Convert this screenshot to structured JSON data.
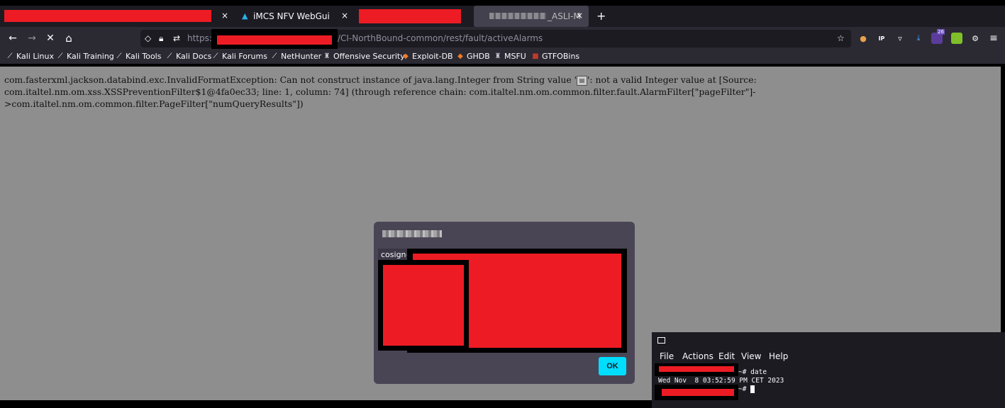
{
  "tabs": [
    {
      "label": "",
      "close": "×"
    },
    {
      "label": "iMCS NFV WebGui",
      "close": "×"
    },
    {
      "label": "",
      "close": ""
    },
    {
      "label": "_ASLI-M",
      "close": "×"
    }
  ],
  "new_tab": "+",
  "nav": {
    "back": "←",
    "forward": "→",
    "stop": "✕",
    "home": "⌂",
    "url_prefix": "https:/",
    "url_suffix": "/CI-NorthBound-common/rest/fault/activeAlarms"
  },
  "toolbar": {
    "badge_count": "26",
    "ip_label": "IP",
    "menu": "≡"
  },
  "bookmarks": [
    {
      "label": "Kali Linux",
      "icon": "kali-dragon-icon"
    },
    {
      "label": "Kali Training",
      "icon": "kali-dragon-icon"
    },
    {
      "label": "Kali Tools",
      "icon": "kali-dragon-icon"
    },
    {
      "label": "Kali Docs",
      "icon": "kali-dragon-icon"
    },
    {
      "label": "Kali Forums",
      "icon": "kali-dragon-icon"
    },
    {
      "label": "NetHunter",
      "icon": "kali-dragon-icon"
    },
    {
      "label": "Offensive Security",
      "icon": "offsec-icon"
    },
    {
      "label": "Exploit-DB",
      "icon": "exploitdb-icon"
    },
    {
      "label": "GHDB",
      "icon": "ghdb-icon"
    },
    {
      "label": "MSFU",
      "icon": "msfu-icon"
    },
    {
      "label": "GTFOBins",
      "icon": "gtfobins-icon"
    }
  ],
  "page": {
    "error_before_icon": "com.fasterxml.jackson.databind.exc.InvalidFormatException: Can not construct instance of java.lang.Integer from String value '",
    "error_after_icon": "': not a valid Integer value at [Source: com.italtel.nm.om.xss.XSSPreventionFilter$1@4fa0ec33; line: 1, column: 74] (through reference chain: com.italtel.nm.om.common.filter.fault.AlarmFilter[\"pageFilter\"]->com.italtel.nm.om.common.filter.PageFilter[\"numQueryResults\"])"
  },
  "dialog": {
    "body_prefix": "cosign=",
    "ok_label": "OK"
  },
  "terminal": {
    "menu": [
      "File",
      "Actions",
      "Edit",
      "View",
      "Help"
    ],
    "prompt_suffix": "~# date",
    "output": "Wed Nov  8 03:52:59 PM CET 2023",
    "prompt2_suffix": "~# "
  },
  "colors": {
    "redaction": "#ed1c24",
    "accent": "#00ddff",
    "page_bg": "#8e8e8e",
    "chrome_bg": "#2b2a33"
  }
}
